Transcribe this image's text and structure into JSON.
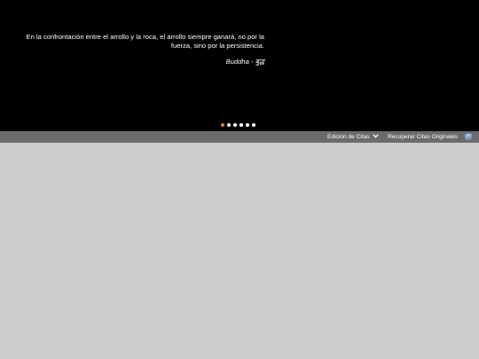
{
  "quote": {
    "text": "En la confrontación entre el arrollo y la roca, el arrollo siempre ganará, no por la fuerza, sino por la persistencia.",
    "author": "Buddha - बुद्ध"
  },
  "carousel": {
    "slides": 6,
    "active_index": 0,
    "active_color": "#e8822a",
    "inactive_color": "#ffffff"
  },
  "toolbar": {
    "edit_label": "Edición de Citas",
    "recover_label": "Recuperar Citas Originales",
    "edit_icon": "chevron-down-icon",
    "recover_icon": "globe-icon"
  },
  "colors": {
    "stage_bg": "#000000",
    "toolbar_bg": "#6b6b6b",
    "content_bg": "#cccccc"
  }
}
